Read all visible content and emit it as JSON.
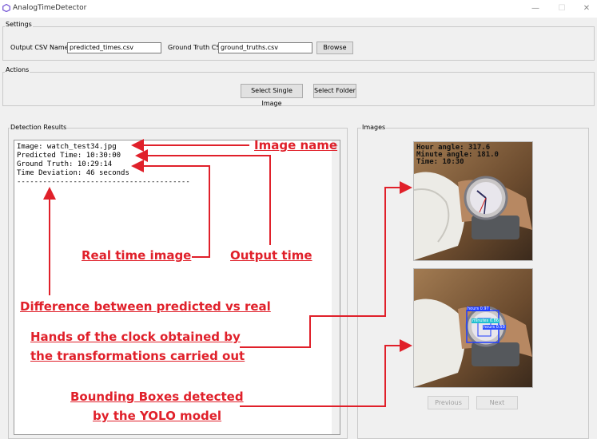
{
  "window": {
    "title": "AnalogTimeDetector",
    "controls": [
      "—",
      "☐",
      "✕"
    ]
  },
  "settings": {
    "group_label": "Settings",
    "output_label": "Output CSV Name:",
    "output_value": "predicted_times.csv",
    "ground_label": "Ground Truth CSV:",
    "ground_value": "ground_truths.csv",
    "browse_label": "Browse"
  },
  "actions": {
    "group_label": "Actions",
    "single_label": "Select Single Image",
    "folder_label": "Select Folder"
  },
  "results": {
    "group_label": "Detection Results",
    "lines": [
      "Image: watch_test34.jpg",
      "Predicted Time: 10:30:00",
      "Ground Truth: 10:29:14",
      "Time Deviation: 46 seconds",
      "----------------------------------------"
    ]
  },
  "images": {
    "group_label": "Images",
    "overlay_lines": [
      "Hour angle: 317.6",
      "Minute angle: 181.0",
      "Time: 10:30"
    ],
    "bbox_labels": [
      "hours 0.97",
      "minutes 0.86",
      "hours 0.50"
    ],
    "previous_label": "Previous",
    "next_label": "Next"
  },
  "annotations": {
    "image_name": "Image name",
    "output_time": "Output time",
    "real_time": "Real time image",
    "difference": "Difference between predicted vs real",
    "hands_1": "Hands of the clock obtained by",
    "hands_2": "the transformations carried out",
    "bbox_1": "Bounding Boxes detected",
    "bbox_2": "by the YOLO model"
  },
  "colors": {
    "annotation": "#e0202a",
    "bbox": "#1e3cff",
    "background": "#f0f0f0"
  }
}
